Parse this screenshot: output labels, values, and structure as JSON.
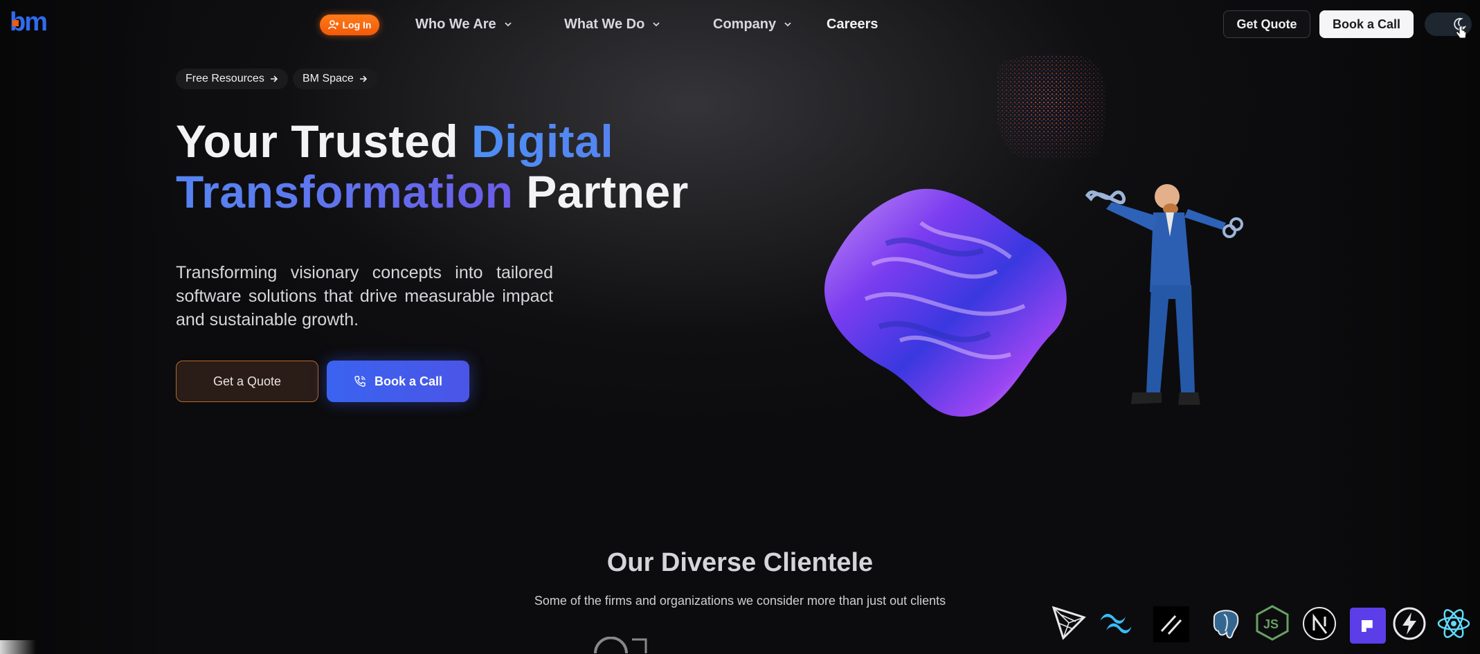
{
  "nav": {
    "logo_text": "bm",
    "login_label": "Log In",
    "items": [
      {
        "label": "Who We Are",
        "has_dropdown": true
      },
      {
        "label": "What We Do",
        "has_dropdown": true
      },
      {
        "label": "Company",
        "has_dropdown": true
      },
      {
        "label": "Careers",
        "has_dropdown": false
      }
    ],
    "get_quote_label": "Get Quote",
    "book_call_label": "Book a Call",
    "theme_toggle_icon": "moon-icon"
  },
  "hero": {
    "chips": [
      "Free Resources",
      "BM Space"
    ],
    "headline_part1": "Your Trusted ",
    "headline_highlight": "Digital Transformation",
    "headline_part2": " Partner",
    "subtext": "Transforming visionary concepts into tailored software solutions that drive measurable impact and sustainable growth.",
    "cta_quote": "Get a Quote",
    "cta_call": "Book a Call"
  },
  "clientele": {
    "title": "Our Diverse Clientele",
    "subtitle": "Some of the firms and organizations we consider more than just out clients"
  },
  "tech_icons": [
    "vite-prism-icon",
    "tailwind-icon",
    "slash-icon",
    "postgresql-icon",
    "nodejs-icon",
    "nextjs-icon",
    "stripe-square-icon",
    "bolt-icon",
    "react-icon"
  ],
  "colors": {
    "accent_orange": "#f15a0a",
    "accent_blue": "#3a63f0",
    "headline_gradient_start": "#4d8ff5",
    "headline_gradient_end": "#6c5ce8",
    "background": "#0c0c0e"
  }
}
